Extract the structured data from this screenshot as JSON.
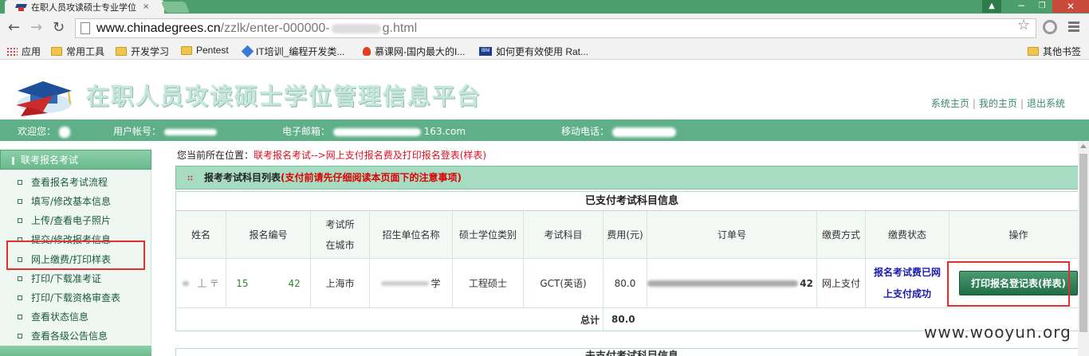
{
  "browser": {
    "tab_title": "在职人员攻读硕士专业学位",
    "tab_close": "×",
    "url_domain": "www.chinadegrees.cn",
    "url_path": "/zzlk/enter-000000-",
    "url_tail": "g.html",
    "back": "←",
    "forward": "→",
    "reload": "↻",
    "star": "☆",
    "window_min": "−",
    "window_max": "❐",
    "window_close": "✕",
    "user_icon": "▲",
    "bookmarks": [
      {
        "label": "应用",
        "icon": "apps-icon"
      },
      {
        "label": "常用工具",
        "icon": "folder-icon"
      },
      {
        "label": "开发学习",
        "icon": "folder-icon"
      },
      {
        "label": "Pentest",
        "icon": "folder-icon"
      },
      {
        "label": "IT培训_编程开发类...",
        "icon": "diamond-icon"
      },
      {
        "label": "慕课网-国内最大的I...",
        "icon": "flame-icon"
      },
      {
        "label": "如何更有效使用 Rat...",
        "icon": "ibm-icon"
      }
    ],
    "bookmarks_other": "其他书签",
    "ibm_text": "IBM"
  },
  "site": {
    "title": "在职人员攻读硕士学位管理信息平台",
    "links": [
      "系统主页",
      "我的主页",
      "退出系统"
    ],
    "link_sep": "|"
  },
  "userbar": {
    "welcome_label": "欢迎您：",
    "account_label": "用户帐号：",
    "email_label": "电子邮箱：",
    "email_visible": "163.com",
    "phone_label": "移动电话："
  },
  "sidebar": {
    "section": "联考报名考试",
    "items": [
      "查看报名考试流程",
      "填写/修改基本信息",
      "上传/查看电子照片",
      "提交/修改报考信息",
      "网上缴费/打印样表",
      "打印/下载准考证",
      "打印/下载资格审查表",
      "查看状态信息",
      "查看各级公告信息"
    ]
  },
  "main": {
    "crumb_label": "您当前所在位置：",
    "crumb_path": "联考报名考试-->网上支付报名费及打印报名登表(样表)",
    "section_title": "报考考试科目列表",
    "section_warning": "(支付前请先仔细阅读本页面下的注意事项)",
    "table_title": "已支付考试科目信息",
    "headers": {
      "name": "姓名",
      "reg_no": "报名编号",
      "city_1": "考试所",
      "city_2": "在城市",
      "school": "招生单位名称",
      "category": "硕士学位类别",
      "subject": "考试科目",
      "fee": "费用(元)",
      "order": "订单号",
      "pay_method": "缴费方式",
      "pay_status": "缴费状态",
      "action": "操作"
    },
    "row": {
      "name": "丄 〒",
      "reg_no_start": "15",
      "reg_no_end": "42",
      "city": "上海市",
      "school_end": "学",
      "category": "工程硕士",
      "subject": "GCT(英语)",
      "fee": "80.0",
      "order_end": "42",
      "pay_method": "网上支付",
      "status_1": "报名考试费已网",
      "status_2": "上支付成功",
      "print_button": "打印报名登记表(样表)"
    },
    "total_label": "总计",
    "total_value": "80.0",
    "table2_title": "未支付考试科目信息"
  },
  "watermark": "www.wooyun.org",
  "colors": {
    "accent": "#5faf89",
    "header_band": "#a7dcc2",
    "highlight": "#e03030",
    "link_blue": "#1a1ab0"
  }
}
